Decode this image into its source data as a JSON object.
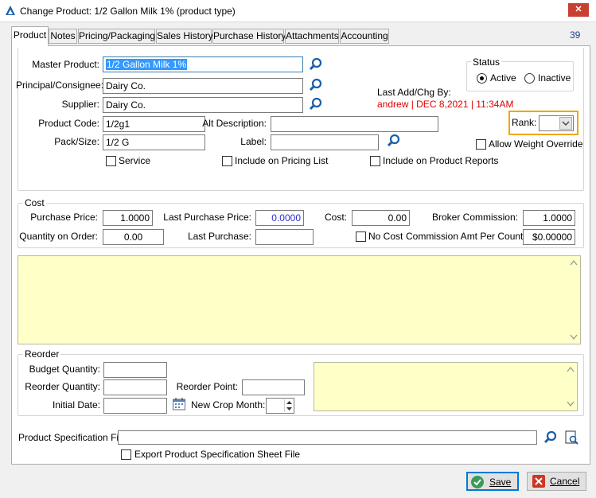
{
  "window": {
    "title": "Change Product: 1/2 Gallon Milk 1% (product type)",
    "close_glyph": "✕",
    "record_count": "39"
  },
  "tabs": [
    "Product",
    "Notes",
    "Pricing/Packaging",
    "Sales History",
    "Purchase History",
    "Attachments",
    "Accounting"
  ],
  "product": {
    "master_product_label": "Master Product:",
    "master_product_value": "1/2 Gallon Milk 1%",
    "principal_label": "Principal/Consignee:",
    "principal_value": "Dairy Co.",
    "supplier_label": "Supplier:",
    "supplier_value": "Dairy Co.",
    "product_code_label": "Product Code:",
    "product_code_value": "1/2g1",
    "alt_description_label": "Alt Description:",
    "alt_description_value": "",
    "pack_size_label": "Pack/Size:",
    "pack_size_value": "1/2 G",
    "label_label": "Label:",
    "label_value": "",
    "service_label": "Service",
    "include_pricing_label": "Include on Pricing List",
    "include_reports_label": "Include on Product Reports"
  },
  "status": {
    "legend": "Status",
    "active_label": "Active",
    "inactive_label": "Inactive",
    "selected": "Active"
  },
  "last_change": {
    "label": "Last Add/Chg By:",
    "value": "andrew | DEC  8,2021 | 11:34AM"
  },
  "rank": {
    "label": "Rank:",
    "value": ""
  },
  "allow_weight_override_label": "Allow Weight Override",
  "cost": {
    "legend": "Cost",
    "purchase_price_label": "Purchase Price:",
    "purchase_price_value": "1.0000",
    "last_purchase_price_label": "Last Purchase Price:",
    "last_purchase_price_value": "0.0000",
    "cost_label": "Cost:",
    "cost_value": "0.00",
    "broker_commission_label": "Broker Commission:",
    "broker_commission_value": "1.0000",
    "quantity_on_order_label": "Quantity on Order:",
    "quantity_on_order_value": "0.00",
    "last_purchase_label": "Last Purchase:",
    "last_purchase_value": "",
    "no_cost_label": "No Cost",
    "commission_amt_label": "Commission Amt Per Count:",
    "commission_amt_value": "$0.00000"
  },
  "reorder": {
    "legend": "Reorder",
    "budget_quantity_label": "Budget Quantity:",
    "reorder_quantity_label": "Reorder Quantity:",
    "reorder_point_label": "Reorder Point:",
    "initial_date_label": "Initial Date:",
    "new_crop_month_label": "New Crop Month:"
  },
  "spec": {
    "file_label": "Product Specification File:",
    "file_value": "",
    "export_label": "Export Product Specification Sheet File"
  },
  "buttons": {
    "save": "Save",
    "cancel": "Cancel"
  },
  "colors": {
    "accent_red": "#e00000",
    "highlight_orange": "#f0a500",
    "notes_yellow": "#ffffc8",
    "selection_blue": "#3399ff"
  }
}
